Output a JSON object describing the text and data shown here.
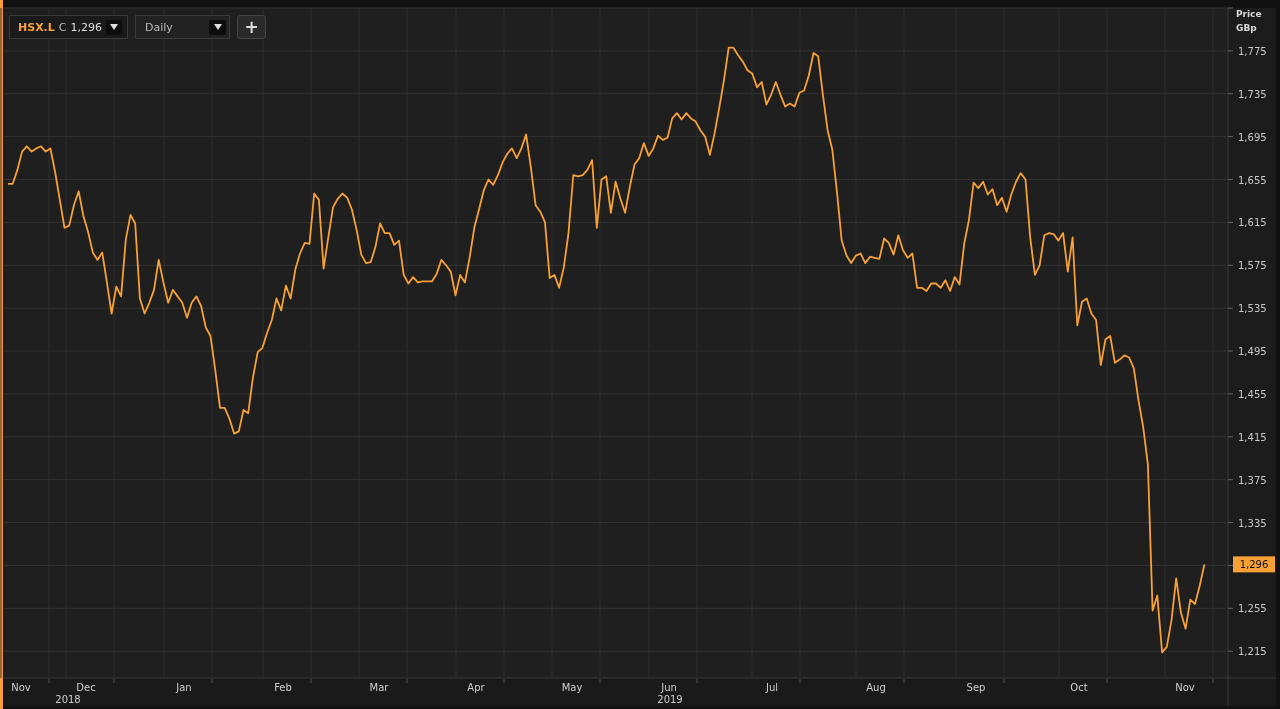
{
  "toolbar": {
    "close_label": "C",
    "close_value": "1,296",
    "interval": "Daily",
    "add_label": "+"
  },
  "chart": {
    "price_label": "Price",
    "currency_label": "GBp",
    "last_price": "1,296",
    "time_axis": [
      {
        "month": "Nov"
      },
      {
        "month": "Dec",
        "year": "2018"
      },
      {
        "month": "Jan"
      },
      {
        "month": "Feb"
      },
      {
        "month": "Mar"
      },
      {
        "month": "Apr"
      },
      {
        "month": "May"
      },
      {
        "month": "Jun",
        "year": "2019"
      },
      {
        "month": "Jul"
      },
      {
        "month": "Aug"
      },
      {
        "month": "Sep"
      },
      {
        "month": "Oct"
      },
      {
        "month": "Nov"
      }
    ],
    "chart_data": {
      "type": "line",
      "grid": true,
      "ylim": [
        1190,
        1815
      ],
      "yticks": [
        {
          "value": 1215,
          "label": "1,215"
        },
        {
          "value": 1255,
          "label": "1,255"
        },
        {
          "value": 1335,
          "label": "1,335"
        },
        {
          "value": 1375,
          "label": "1,375"
        },
        {
          "value": 1415,
          "label": "1,415"
        },
        {
          "value": 1455,
          "label": "1,455"
        },
        {
          "value": 1495,
          "label": "1,495"
        },
        {
          "value": 1535,
          "label": "1,535"
        },
        {
          "value": 1575,
          "label": "1,575"
        },
        {
          "value": 1615,
          "label": "1,615"
        },
        {
          "value": 1655,
          "label": "1,655"
        },
        {
          "value": 1695,
          "label": "1,695"
        },
        {
          "value": 1735,
          "label": "1,735"
        },
        {
          "value": 1775,
          "label": "1,775"
        }
      ],
      "series": [
        {
          "name": "HSX.L",
          "color": "#f7a035",
          "values": [
            1651,
            1651,
            1664,
            1681,
            1686,
            1681,
            1684,
            1686,
            1681,
            1684,
            1662,
            1636,
            1610,
            1612,
            1631,
            1644,
            1621,
            1606,
            1587,
            1580,
            1587,
            1559,
            1530,
            1555,
            1546,
            1599,
            1622,
            1614,
            1544,
            1530,
            1540,
            1552,
            1580,
            1559,
            1540,
            1552,
            1546,
            1540,
            1526,
            1540,
            1546,
            1537,
            1517,
            1509,
            1477,
            1442,
            1442,
            1432,
            1418,
            1420,
            1440,
            1437,
            1470,
            1494,
            1498,
            1512,
            1524,
            1544,
            1533,
            1556,
            1544,
            1571,
            1586,
            1596,
            1595,
            1642,
            1636,
            1572,
            1601,
            1629,
            1637,
            1642,
            1638,
            1627,
            1608,
            1585,
            1577,
            1578,
            1592,
            1614,
            1605,
            1605,
            1594,
            1598,
            1566,
            1558,
            1564,
            1559,
            1560,
            1560,
            1560,
            1567,
            1580,
            1575,
            1569,
            1547,
            1566,
            1559,
            1582,
            1610,
            1627,
            1645,
            1655,
            1650,
            1659,
            1671,
            1679,
            1684,
            1675,
            1684,
            1697,
            1666,
            1631,
            1625,
            1615,
            1563,
            1566,
            1554,
            1573,
            1605,
            1659,
            1658,
            1659,
            1664,
            1673,
            1610,
            1655,
            1658,
            1624,
            1653,
            1637,
            1624,
            1648,
            1669,
            1675,
            1689,
            1677,
            1684,
            1696,
            1692,
            1694,
            1712,
            1717,
            1711,
            1717,
            1712,
            1709,
            1701,
            1695,
            1678,
            1698,
            1722,
            1748,
            1778,
            1778,
            1771,
            1765,
            1757,
            1754,
            1741,
            1746,
            1725,
            1734,
            1746,
            1734,
            1723,
            1726,
            1723,
            1736,
            1738,
            1752,
            1773,
            1770,
            1734,
            1701,
            1683,
            1643,
            1598,
            1584,
            1577,
            1584,
            1586,
            1577,
            1583,
            1582,
            1581,
            1600,
            1596,
            1585,
            1603,
            1589,
            1582,
            1586,
            1554,
            1554,
            1551,
            1558,
            1558,
            1554,
            1561,
            1551,
            1564,
            1557,
            1595,
            1617,
            1652,
            1647,
            1653,
            1641,
            1646,
            1631,
            1638,
            1625,
            1641,
            1653,
            1661,
            1655,
            1601,
            1566,
            1575,
            1603,
            1605,
            1604,
            1598,
            1605,
            1569,
            1601,
            1519,
            1541,
            1544,
            1530,
            1524,
            1482,
            1506,
            1509,
            1484,
            1487,
            1491,
            1489,
            1479,
            1449,
            1424,
            1389,
            1253,
            1267,
            1214,
            1219,
            1244,
            1283,
            1251,
            1236,
            1263,
            1259,
            1276,
            1296
          ]
        }
      ]
    }
  }
}
